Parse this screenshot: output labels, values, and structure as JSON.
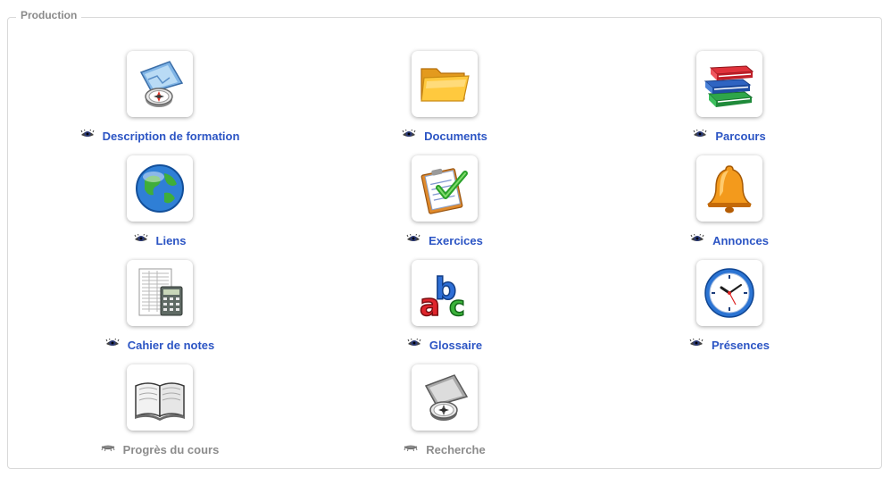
{
  "section": {
    "legend": "Production"
  },
  "tools": [
    {
      "id": "description",
      "label": "Description de formation",
      "icon": "compass-map-icon",
      "visible": true
    },
    {
      "id": "documents",
      "label": "Documents",
      "icon": "folder-icon",
      "visible": true
    },
    {
      "id": "parcours",
      "label": "Parcours",
      "icon": "books-icon",
      "visible": true
    },
    {
      "id": "liens",
      "label": "Liens",
      "icon": "globe-icon",
      "visible": true
    },
    {
      "id": "exercices",
      "label": "Exercices",
      "icon": "checklist-icon",
      "visible": true
    },
    {
      "id": "annonces",
      "label": "Annonces",
      "icon": "bell-icon",
      "visible": true
    },
    {
      "id": "cahier",
      "label": "Cahier de notes",
      "icon": "calculator-sheet-icon",
      "visible": true
    },
    {
      "id": "glossaire",
      "label": "Glossaire",
      "icon": "abc-letters-icon",
      "visible": true
    },
    {
      "id": "presences",
      "label": "Présences",
      "icon": "clock-icon",
      "visible": true
    },
    {
      "id": "progres",
      "label": "Progrès du cours",
      "icon": "open-book-icon",
      "visible": false
    },
    {
      "id": "recherche",
      "label": "Recherche",
      "icon": "compass-search-icon",
      "visible": false
    }
  ],
  "colors": {
    "link": "#2c55c4",
    "disabled_link": "#8c8c8c",
    "legend": "#8a8a8a",
    "border": "#d9d9d9"
  }
}
